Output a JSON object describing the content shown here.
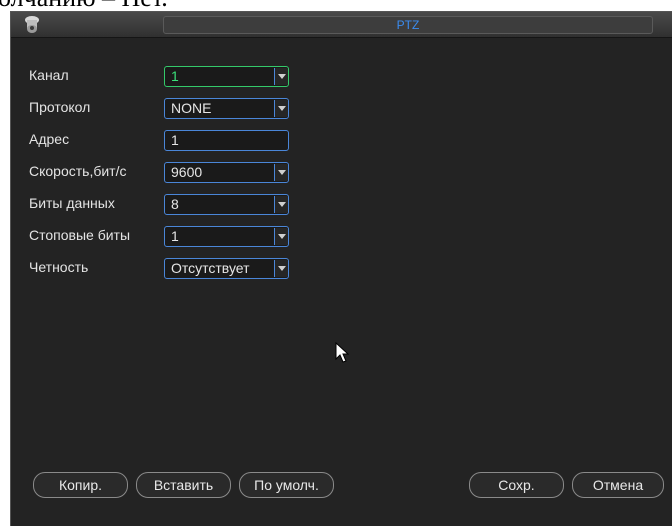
{
  "doc_fragment": "олчанию – Нет.",
  "window": {
    "title": "PTZ"
  },
  "fields": [
    {
      "label": "Канал",
      "value": "1"
    },
    {
      "label": "Протокол",
      "value": "NONE"
    },
    {
      "label": "Адрес",
      "value": "1"
    },
    {
      "label": "Скорость,бит/с",
      "value": "9600"
    },
    {
      "label": "Биты данных",
      "value": "8"
    },
    {
      "label": "Стоповые биты",
      "value": "1"
    },
    {
      "label": "Четность",
      "value": "Отсутствует"
    }
  ],
  "buttons": {
    "copy": "Копир.",
    "paste": "Вставить",
    "default": "По умолч.",
    "save": "Сохр.",
    "cancel": "Отмена"
  },
  "colors": {
    "accent": "#4a86d8",
    "active": "#34c96a",
    "background": "#232323",
    "title_text": "#3a8cf0"
  }
}
